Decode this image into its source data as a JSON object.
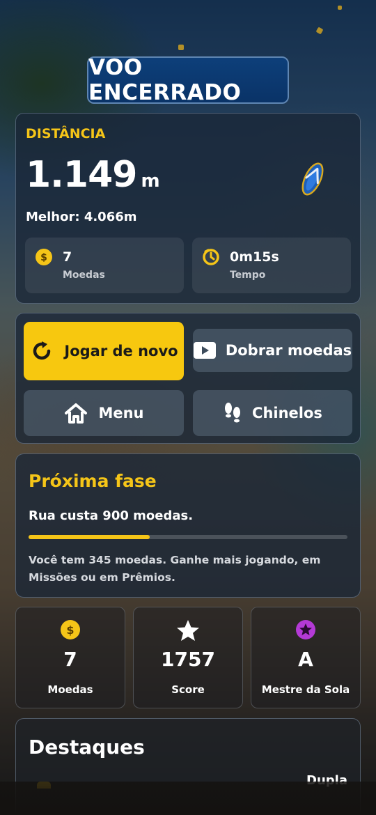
{
  "header": {
    "title": "VOO ENCERRADO"
  },
  "stats": {
    "distance_label": "DISTÂNCIA",
    "distance_value": "1.149",
    "distance_unit": "m",
    "best": "Melhor: 4.066m",
    "coins": {
      "value": "7",
      "label": "Moedas",
      "icon": "coin-icon"
    },
    "time": {
      "value": "0m15s",
      "label": "Tempo",
      "icon": "timer-icon"
    }
  },
  "actions": {
    "play_again": "Jogar de novo",
    "double_coins": "Dobrar moedas",
    "menu": "Menu",
    "flipflops": "Chinelos"
  },
  "next_phase": {
    "title": "Próxima fase",
    "cost_text": "Rua custa 900 moedas.",
    "progress": 0.38,
    "note": "Você tem 345 moedas. Ganhe mais jogando, em Missões ou em Prêmios."
  },
  "summary": [
    {
      "value": "7",
      "label": "Moedas",
      "icon": "coin-icon"
    },
    {
      "value": "1757",
      "label": "Score",
      "icon": "star-icon"
    },
    {
      "value": "A",
      "label": "Mestre da Sola",
      "icon": "rank-star-icon"
    }
  ],
  "highlights": {
    "title": "Destaques",
    "peek_text": "Dupla"
  },
  "colors": {
    "accent_yellow": "#f5c518",
    "title_blue": "#0d3f7a",
    "rank_purple": "#b43ad6"
  }
}
